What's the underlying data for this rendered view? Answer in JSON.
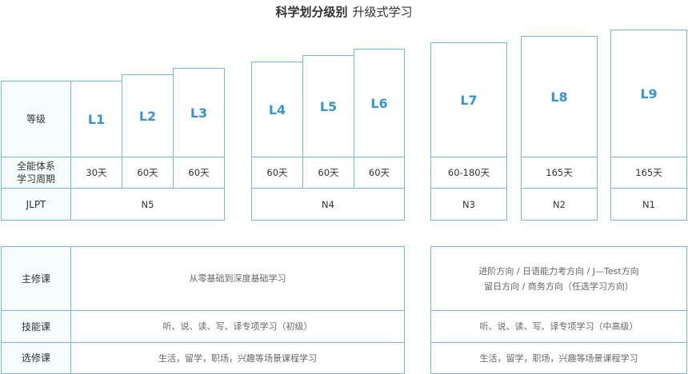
{
  "title": {
    "bold": "科学划分级别",
    "rest": "升级式学习"
  },
  "row_labels": {
    "level": "等级",
    "cycle_1": "全能体系",
    "cycle_2": "学习周期",
    "jlpt": "JLPT"
  },
  "levels": [
    "L1",
    "L2",
    "L3",
    "L4",
    "L5",
    "L6",
    "L7",
    "L8",
    "L9"
  ],
  "durations": [
    "30天",
    "60天",
    "60天",
    "60天",
    "60天",
    "60天",
    "60-180天",
    "165天",
    "165天"
  ],
  "jlpt": [
    "N5",
    "N4",
    "N3",
    "N2",
    "N1"
  ],
  "courses": {
    "labels": [
      "主修课",
      "技能课",
      "选修课"
    ],
    "left": {
      "major": "从零基础到深度基础学习",
      "skill": "听、说、读、写、译专项学习（初级）",
      "elective": "生活，留学，职场，兴趣等场景课程学习"
    },
    "right": {
      "major_1": "进阶方向 / 日语能力考方向 / J—Test方向",
      "major_2": "留日方向 / 商务方向（任选学习方向）",
      "skill": "听、说、读、写、译专项学习（中高级）",
      "elective": "生活，留学，职场，兴趣等场景课程学习"
    }
  }
}
